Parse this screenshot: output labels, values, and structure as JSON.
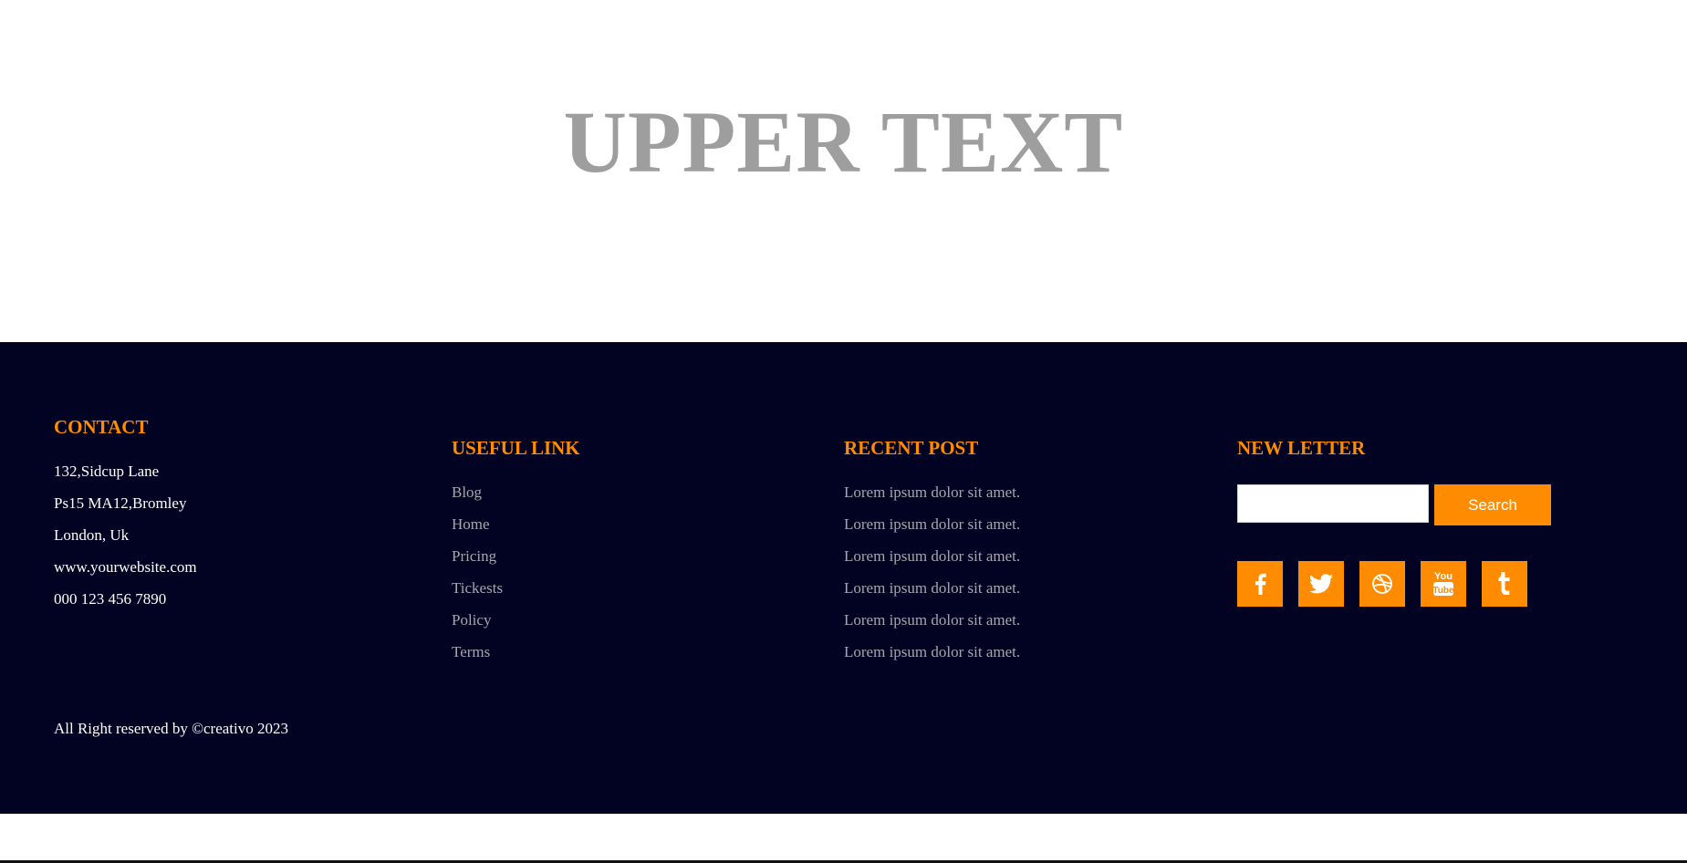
{
  "hero": {
    "title": "UPPER TEXT"
  },
  "footer": {
    "contact": {
      "heading": "CONTACT",
      "lines": [
        "132,Sidcup Lane",
        "Ps15 MA12,Bromley",
        "London, Uk",
        "www.yourwebsite.com",
        "000 123 456 7890"
      ]
    },
    "useful_link": {
      "heading": "USEFUL LINK",
      "links": [
        "Blog",
        "Home",
        "Pricing",
        "Tickests",
        "Policy",
        "Terms"
      ]
    },
    "recent_post": {
      "heading": "RECENT POST",
      "posts": [
        "Lorem ipsum dolor sit amet.",
        "Lorem ipsum dolor sit amet.",
        "Lorem ipsum dolor sit amet.",
        "Lorem ipsum dolor sit amet.",
        "Lorem ipsum dolor sit amet.",
        "Lorem ipsum dolor sit amet."
      ]
    },
    "newsletter": {
      "heading": "NEW LETTER",
      "input_value": "",
      "search_label": "Search",
      "social_icons": [
        "facebook-icon",
        "twitter-icon",
        "dribbble-icon",
        "youtube-icon",
        "tumblr-icon"
      ]
    },
    "copyright": "All Right reserved by ©creativo 2023"
  },
  "colors": {
    "accent": "#ff8c00",
    "footer_bg": "#020222",
    "hero_text": "#9e9e9e",
    "link_text": "#a6a6ac",
    "white_text": "#ffffff"
  }
}
